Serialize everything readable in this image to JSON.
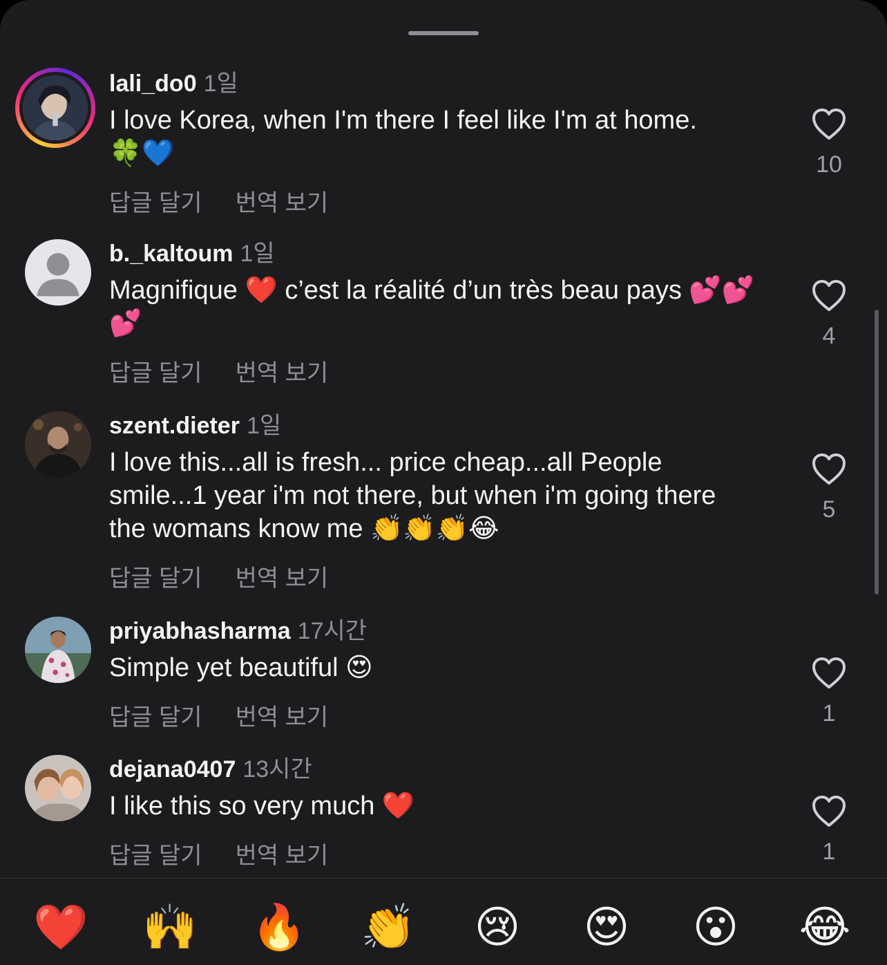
{
  "comments": [
    {
      "username": "lali_do0",
      "time": "1일",
      "text": "I love Korea, when I'm there I feel like I'm at home.🍀💙",
      "likes": "10",
      "reply_label": "답글 달기",
      "translate_label": "번역 보기"
    },
    {
      "username": "b._kaltoum",
      "time": "1일",
      "text": "Magnifique ❤️ c’est la réalité d’un très beau pays 💕💕💕",
      "likes": "4",
      "reply_label": "답글 달기",
      "translate_label": "번역 보기"
    },
    {
      "username": "szent.dieter",
      "time": "1일",
      "text": "I love this...all is fresh... price cheap...all People smile...1 year i'm not there, but when i'm going there the womans know me 👏👏👏😂",
      "likes": "5",
      "reply_label": "답글 달기",
      "translate_label": "번역 보기"
    },
    {
      "username": "priyabhasharma",
      "time": "17시간",
      "text": "Simple yet beautiful 😍",
      "likes": "1",
      "reply_label": "답글 달기",
      "translate_label": "번역 보기"
    },
    {
      "username": "dejana0407",
      "time": "13시간",
      "text": "I like this so very much ❤️",
      "likes": "1",
      "reply_label": "답글 달기",
      "translate_label": "번역 보기"
    }
  ],
  "emoji_bar": [
    "❤️",
    "🙌",
    "🔥",
    "👏",
    "😢",
    "😍",
    "😮",
    "😂"
  ],
  "colors": {
    "background": "#1c1c1e",
    "text": "#f5f5f5",
    "secondary_text": "#8e8e93"
  }
}
